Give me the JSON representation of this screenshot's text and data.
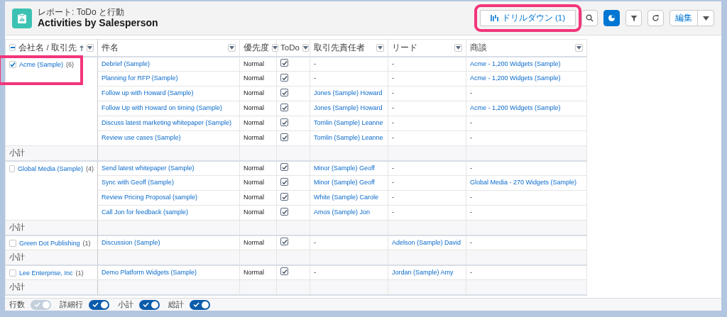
{
  "header": {
    "subtitle": "レポート: ToDo と行動",
    "title": "Activities by Salesperson"
  },
  "toolbar": {
    "drilldown": {
      "label": "ドリルダウン (1)",
      "highlighted": true
    },
    "chart_button": {
      "selected": true
    },
    "edit_label": "編集"
  },
  "columns": [
    {
      "label": "会社名 / 取引先",
      "sorted": true,
      "indeterminate": true
    },
    {
      "label": "件名"
    },
    {
      "label": "優先度"
    },
    {
      "label": "ToDo"
    },
    {
      "label": "取引先責任者"
    },
    {
      "label": "リード"
    },
    {
      "label": "商談"
    }
  ],
  "groups": [
    {
      "name": "Acme (Sample)",
      "count": "(6)",
      "checked": true,
      "highlighted": true,
      "subtotal": "小計",
      "rows": [
        {
          "subject": "Debrief (Sample)",
          "priority": "Normal",
          "todo": true,
          "cells": [
            {
              "text": "-",
              "link": false
            },
            {
              "text": "-",
              "link": false
            },
            {
              "text": "Acme - 1,200 Widgets (Sample)",
              "link": true
            }
          ]
        },
        {
          "subject": "Planning for RFP (Sample)",
          "priority": "Normal",
          "todo": true,
          "cells": [
            {
              "text": "-",
              "link": false
            },
            {
              "text": "-",
              "link": false
            },
            {
              "text": "Acme - 1,200 Widgets (Sample)",
              "link": true
            }
          ]
        },
        {
          "subject": "Follow up with Howard (Sample)",
          "priority": "Normal",
          "todo": true,
          "cells": [
            {
              "text": "Jones (Sample) Howard",
              "link": true
            },
            {
              "text": "-",
              "link": false
            },
            {
              "text": "-",
              "link": false
            }
          ]
        },
        {
          "subject": "Follow Up with Howard on timing (Sample)",
          "priority": "Normal",
          "todo": true,
          "cells": [
            {
              "text": "Jones (Sample) Howard",
              "link": true
            },
            {
              "text": "-",
              "link": false
            },
            {
              "text": "Acme - 1,200 Widgets (Sample)",
              "link": true
            }
          ]
        },
        {
          "subject": "Discuss latest marketing whitepaper (Sample)",
          "priority": "Normal",
          "todo": true,
          "cells": [
            {
              "text": "Tomlin (Sample) Leanne",
              "link": true
            },
            {
              "text": "-",
              "link": false
            },
            {
              "text": "-",
              "link": false
            }
          ]
        },
        {
          "subject": "Review use cases (Sample)",
          "priority": "Normal",
          "todo": true,
          "cells": [
            {
              "text": "Tomlin (Sample) Leanne",
              "link": true
            },
            {
              "text": "-",
              "link": false
            },
            {
              "text": "-",
              "link": false
            }
          ]
        }
      ]
    },
    {
      "name": "Global Media (Sample)",
      "count": "(4)",
      "checked": false,
      "subtotal": "小計",
      "rows": [
        {
          "subject": "Send latest whitepaper (Sample)",
          "priority": "Normal",
          "todo": true,
          "cells": [
            {
              "text": "Minor (Sample) Geoff",
              "link": true
            },
            {
              "text": "-",
              "link": false
            },
            {
              "text": "-",
              "link": false
            }
          ]
        },
        {
          "subject": "Sync with Geoff (Sample)",
          "priority": "Normal",
          "todo": true,
          "cells": [
            {
              "text": "Minor (Sample) Geoff",
              "link": true
            },
            {
              "text": "-",
              "link": false
            },
            {
              "text": "Global Media - 270 Widgets (Sample)",
              "link": true
            }
          ]
        },
        {
          "subject": "Review Pricing Proposal (sample)",
          "priority": "Normal",
          "todo": true,
          "cells": [
            {
              "text": "White (Sample) Carole",
              "link": true
            },
            {
              "text": "-",
              "link": false
            },
            {
              "text": "-",
              "link": false
            }
          ]
        },
        {
          "subject": "Call Jon for feedback (sample)",
          "priority": "Normal",
          "todo": true,
          "cells": [
            {
              "text": "Amos (Sample) Jon",
              "link": true
            },
            {
              "text": "-",
              "link": false
            },
            {
              "text": "-",
              "link": false
            }
          ]
        }
      ]
    },
    {
      "name": "Green Dot Publishing",
      "count": "(1)",
      "checked": false,
      "subtotal": "小計",
      "rows": [
        {
          "subject": "Discussion (Sample)",
          "priority": "Normal",
          "todo": true,
          "cells": [
            {
              "text": "-",
              "link": false
            },
            {
              "text": "Adelson (Sample) David",
              "link": true
            },
            {
              "text": "-",
              "link": false
            }
          ]
        }
      ]
    },
    {
      "name": "Lee Enterprise, Inc",
      "count": "(1)",
      "checked": false,
      "subtotal": "小計",
      "rows": [
        {
          "subject": "Demo Platform Widgets (Sample)",
          "priority": "Normal",
          "todo": true,
          "cells": [
            {
              "text": "-",
              "link": false
            },
            {
              "text": "Jordan (Sample) Amy",
              "link": true
            },
            {
              "text": "-",
              "link": false
            }
          ]
        }
      ]
    }
  ],
  "footer": {
    "toggles": [
      {
        "label": "行数",
        "on": true,
        "disabled": true
      },
      {
        "label": "詳細行",
        "on": true,
        "disabled": false
      },
      {
        "label": "小計",
        "on": true,
        "disabled": false
      },
      {
        "label": "総計",
        "on": true,
        "disabled": false
      }
    ]
  }
}
